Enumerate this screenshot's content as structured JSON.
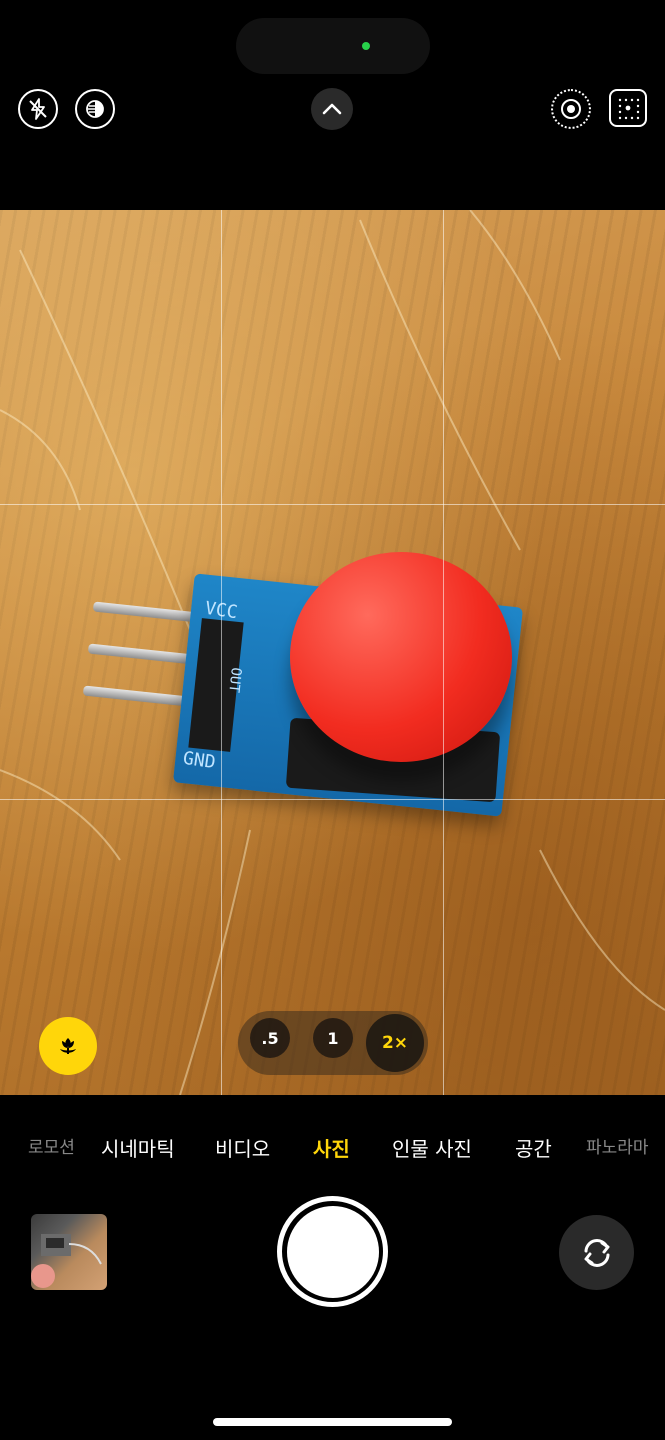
{
  "top_bar": {
    "flash_icon": "flash-off-icon",
    "night_icon": "night-mode-icon",
    "expand_icon": "chevron-up-icon",
    "live_icon": "live-photo-icon",
    "styles_icon": "photographic-styles-icon"
  },
  "viewfinder": {
    "grid": "on",
    "pcb_labels": {
      "vcc": "VCC",
      "out": "OUT",
      "gnd": "GND"
    },
    "macro_icon": "macro-flower-icon"
  },
  "zoom": {
    "options": [
      ".5",
      "1",
      "2×"
    ],
    "selected": "2×"
  },
  "modes": {
    "items": [
      "로모션",
      "시네마틱",
      "비디오",
      "사진",
      "인물 사진",
      "공간",
      "파노라마"
    ],
    "selected": "사진"
  },
  "bottom": {
    "thumbnail": "last-photo-thumbnail",
    "shutter": "shutter-button",
    "flip_icon": "camera-flip-icon"
  },
  "colors": {
    "accent": "#ffd60a",
    "indicator": "#27d14a"
  }
}
